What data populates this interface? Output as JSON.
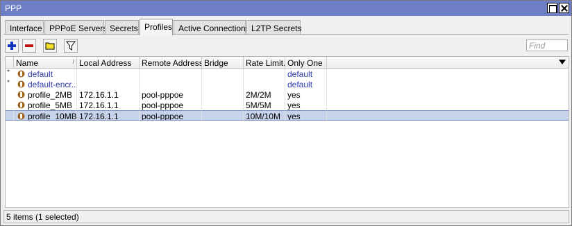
{
  "window": {
    "title": "PPP"
  },
  "tabs": [
    {
      "label": "Interface"
    },
    {
      "label": "PPPoE Servers"
    },
    {
      "label": "Secrets"
    },
    {
      "label": "Profiles",
      "active": true
    },
    {
      "label": "Active Connections"
    },
    {
      "label": "L2TP Secrets"
    }
  ],
  "toolbar": {
    "add_icon": "plus-icon",
    "remove_icon": "minus-icon",
    "comment_icon": "comment-icon",
    "filter_icon": "filter-icon",
    "find_placeholder": "Find"
  },
  "table": {
    "columns": [
      "Name",
      "Local Address",
      "Remote Address",
      "Bridge",
      "Rate Limit...",
      "Only One"
    ],
    "sort_mark": "/",
    "rows": [
      {
        "flag": "*",
        "name": "default",
        "local": "",
        "remote": "",
        "bridge": "",
        "rate": "",
        "only_one": "default",
        "is_default": true,
        "selected": false
      },
      {
        "flag": "*",
        "name": "default-encr...",
        "local": "",
        "remote": "",
        "bridge": "",
        "rate": "",
        "only_one": "default",
        "is_default": true,
        "selected": false
      },
      {
        "flag": "",
        "name": "profile_2MB",
        "local": "172.16.1.1",
        "remote": "pool-pppoe",
        "bridge": "",
        "rate": "2M/2M",
        "only_one": "yes",
        "is_default": false,
        "selected": false
      },
      {
        "flag": "",
        "name": "profile_5MB",
        "local": "172.16.1.1",
        "remote": "pool-pppoe",
        "bridge": "",
        "rate": "5M/5M",
        "only_one": "yes",
        "is_default": false,
        "selected": false
      },
      {
        "flag": "",
        "name": "profile_10MB",
        "local": "172.16.1.1",
        "remote": "pool-pppoe",
        "bridge": "",
        "rate": "10M/10M",
        "only_one": "yes",
        "is_default": false,
        "selected": true
      }
    ]
  },
  "status": {
    "text": "5 items (1 selected)"
  },
  "colors": {
    "titlebar": "#6e7fc7",
    "selected_row": "#c7d3eb",
    "default_text": "#2d3aa8",
    "profile_icon": "#a0641e"
  }
}
